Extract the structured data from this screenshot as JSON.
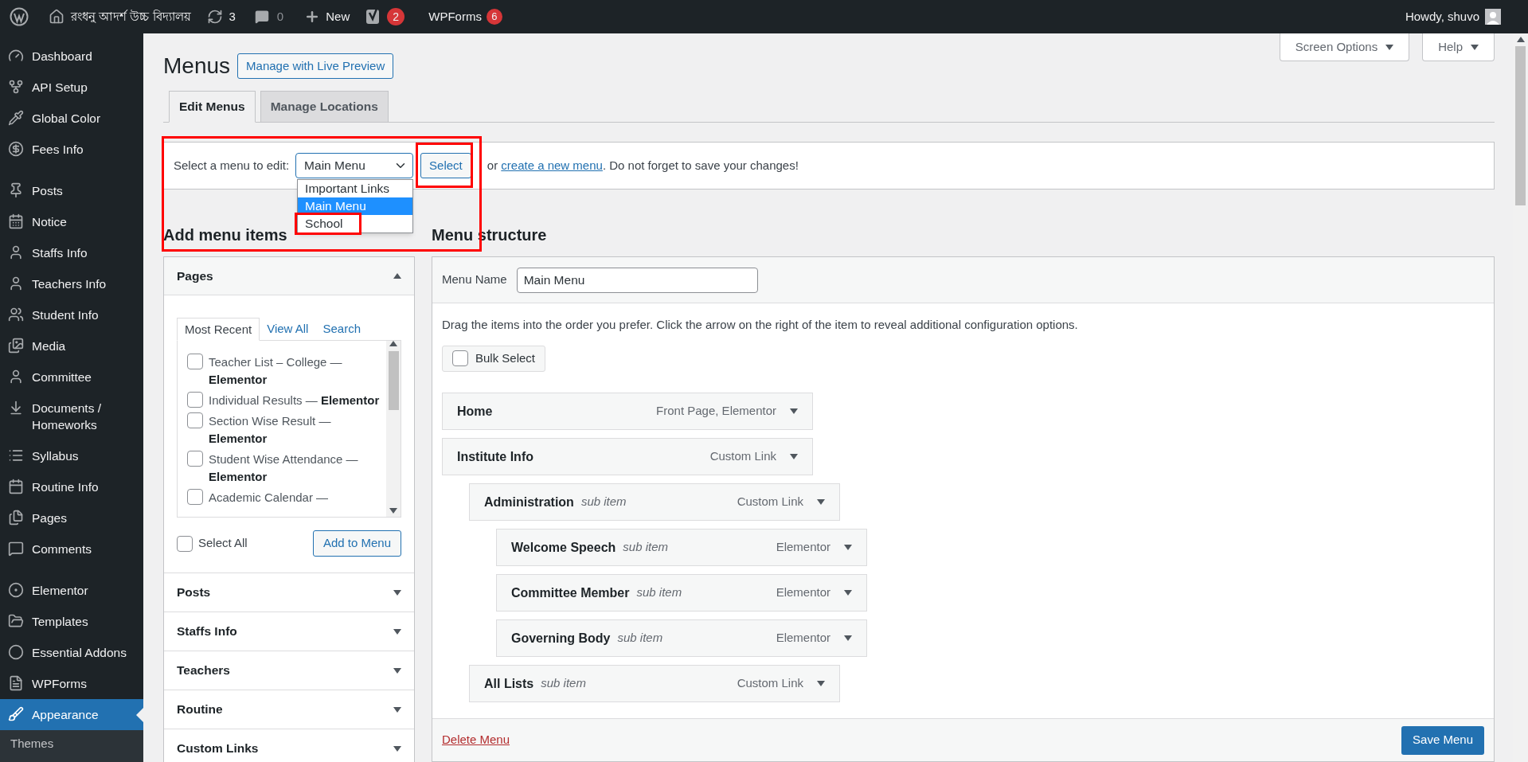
{
  "admin_bar": {
    "site_name": "রংধনু আদর্শ উচ্চ বিদ্যালয়",
    "updates": "3",
    "comments": "0",
    "new": "New",
    "seo_badge": "2",
    "forms": "WPForms",
    "forms_badge": "6",
    "greeting": "Howdy, shuvo"
  },
  "sidebar": {
    "sections": [
      {
        "items": [
          {
            "label": "Dashboard",
            "selected": false
          },
          {
            "label": "API Setup",
            "selected": false
          },
          {
            "label": "Global Color",
            "selected": false
          },
          {
            "label": "Fees Info",
            "selected": false
          }
        ]
      },
      {
        "items": [
          {
            "label": "Posts",
            "selected": false
          },
          {
            "label": "Notice",
            "selected": false
          },
          {
            "label": "Staffs Info",
            "selected": false
          },
          {
            "label": "Teachers Info",
            "selected": false
          },
          {
            "label": "Student Info",
            "selected": false
          },
          {
            "label": "Media",
            "selected": false
          },
          {
            "label": "Committee",
            "selected": false
          },
          {
            "label": "Documents / Homeworks",
            "selected": false
          },
          {
            "label": "Syllabus",
            "selected": false
          },
          {
            "label": "Routine Info",
            "selected": false
          },
          {
            "label": "Pages",
            "selected": false
          },
          {
            "label": "Comments",
            "selected": false
          }
        ]
      },
      {
        "items": [
          {
            "label": "Elementor",
            "selected": false
          },
          {
            "label": "Templates",
            "selected": false
          },
          {
            "label": "Essential Addons",
            "selected": false
          },
          {
            "label": "WPForms",
            "selected": false
          },
          {
            "label": "Appearance",
            "selected": true
          }
        ]
      }
    ],
    "submenu": [
      "Themes"
    ]
  },
  "screen_options": "Screen Options",
  "help": "Help",
  "page_title": "Menus",
  "live_preview": "Manage with Live Preview",
  "tabs": [
    {
      "label": "Edit Menus",
      "selected": true
    },
    {
      "label": "Manage Locations",
      "selected": false
    }
  ],
  "select_bar": {
    "label": "Select a menu to edit:",
    "value": "Main Menu",
    "select_button": "Select",
    "after_prefix": "or ",
    "link": "create a new menu",
    "after": ". Do not forget to save your changes!",
    "options": [
      {
        "label": "Important Links",
        "selected": false
      },
      {
        "label": "Main Menu",
        "selected": true
      },
      {
        "label": "School",
        "selected": false
      }
    ]
  },
  "add_items": {
    "title": "Add menu items",
    "sections": [
      {
        "title": "Pages",
        "expanded": true
      },
      {
        "title": "Posts",
        "expanded": false
      },
      {
        "title": "Staffs Info",
        "expanded": false
      },
      {
        "title": "Teachers",
        "expanded": false
      },
      {
        "title": "Routine",
        "expanded": false
      },
      {
        "title": "Custom Links",
        "expanded": false
      }
    ],
    "page_tabs": [
      {
        "label": "Most Recent",
        "selected": true
      },
      {
        "label": "View All",
        "selected": false
      },
      {
        "label": "Search",
        "selected": false
      }
    ],
    "pages": [
      {
        "label": "Teacher List – College — **Elementor**",
        "checked": false
      },
      {
        "label": "Individual Results — **Elementor**",
        "checked": false
      },
      {
        "label": "Section Wise Result — **Elementor**",
        "checked": false
      },
      {
        "label": "Student Wise Attendance — **Elementor**",
        "checked": false
      },
      {
        "label": "Academic Calendar —",
        "checked": false
      }
    ],
    "select_all": {
      "label": "Select All",
      "checked": false
    },
    "add_button": "Add to Menu"
  },
  "menu_structure": {
    "title": "Menu structure",
    "name_label": "Menu Name",
    "name_value": "Main Menu",
    "instructions": "Drag the items into the order you prefer. Click the arrow on the right of the item to reveal additional configuration options.",
    "bulk_select": {
      "label": "Bulk Select",
      "checked": false
    },
    "items": [
      {
        "title": "Home",
        "type": "Front Page, Elementor"
      },
      {
        "title": "Institute Info",
        "type": "Custom Link",
        "children": [
          {
            "title": "Administration",
            "note": "sub item",
            "type": "Custom Link",
            "children": [
              {
                "title": "Welcome Speech",
                "note": "sub item",
                "type": "Elementor"
              },
              {
                "title": "Committee Member",
                "note": "sub item",
                "type": "Elementor"
              },
              {
                "title": "Governing Body",
                "note": "sub item",
                "type": "Elementor"
              }
            ]
          },
          {
            "title": "All Lists",
            "note": "sub item",
            "type": "Custom Link"
          }
        ]
      }
    ],
    "delete": "Delete Menu",
    "save": "Save Menu"
  }
}
